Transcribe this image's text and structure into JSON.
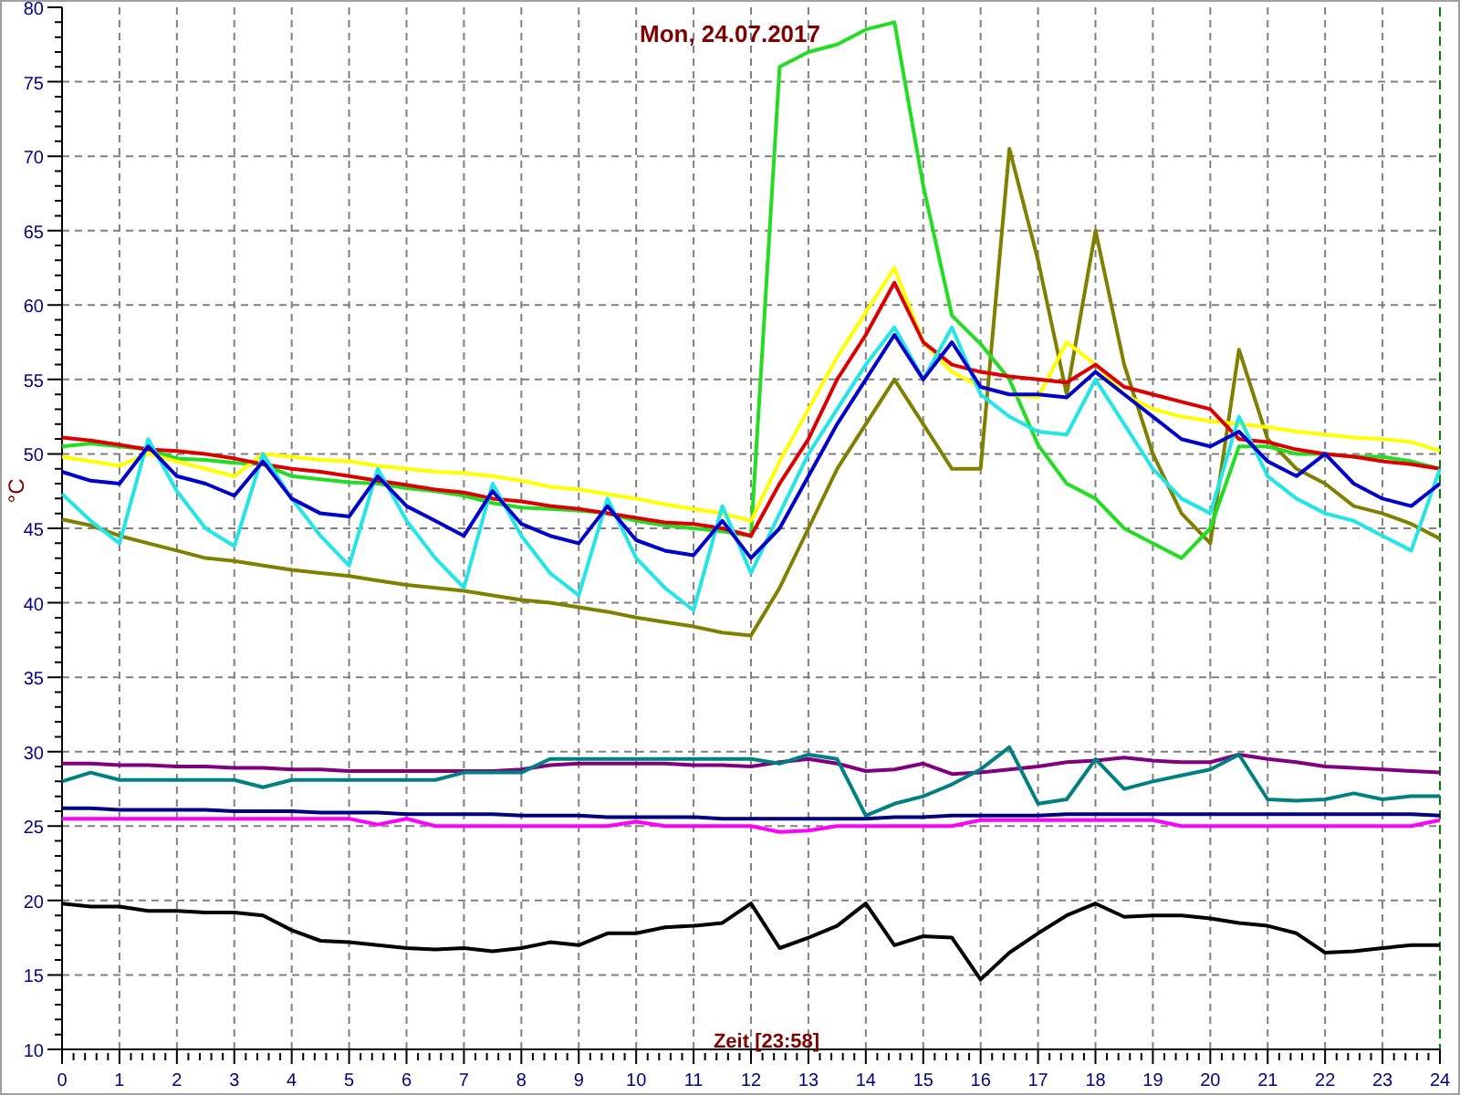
{
  "chart_data": {
    "type": "line",
    "title": "Mon, 24.07.2017",
    "xlabel": "Zeit [23:58]",
    "ylabel": "°C",
    "x": [
      0,
      0.5,
      1,
      1.5,
      2,
      2.5,
      3,
      3.5,
      4,
      4.5,
      5,
      5.5,
      6,
      6.5,
      7,
      7.5,
      8,
      8.5,
      9,
      9.5,
      10,
      10.5,
      11,
      11.5,
      12,
      12.5,
      13,
      13.5,
      14,
      14.5,
      15,
      15.5,
      16,
      16.5,
      17,
      17.5,
      18,
      18.5,
      19,
      19.5,
      20,
      20.5,
      21,
      21.5,
      22,
      22.5,
      23,
      23.5,
      24
    ],
    "grid": true,
    "xlim": [
      0,
      24
    ],
    "ylim": [
      10,
      80
    ],
    "xticks": [
      0,
      1,
      2,
      3,
      4,
      5,
      6,
      7,
      8,
      9,
      10,
      11,
      12,
      13,
      14,
      15,
      16,
      17,
      18,
      19,
      20,
      21,
      22,
      23,
      24
    ],
    "yticks": [
      10,
      15,
      20,
      25,
      30,
      35,
      40,
      45,
      50,
      55,
      60,
      65,
      70,
      75,
      80
    ],
    "series": [
      {
        "color": "#808000",
        "values": [
          45.6,
          45.2,
          44.5,
          44,
          43.5,
          43,
          42.8,
          42.5,
          42.2,
          42,
          41.8,
          41.5,
          41.2,
          41,
          40.8,
          40.5,
          40.2,
          40,
          39.7,
          39.4,
          39,
          38.7,
          38.4,
          38,
          37.8,
          41,
          45,
          49,
          52,
          55,
          52,
          49,
          49,
          70.5,
          63,
          54,
          65,
          56,
          50,
          46,
          44,
          57,
          51,
          49,
          48,
          46.5,
          46,
          45.3,
          44.3
        ]
      },
      {
        "color": "#22dd22",
        "values": [
          50.5,
          50.7,
          50.5,
          50.3,
          49.7,
          49.6,
          49.4,
          49.3,
          48.5,
          48.3,
          48.1,
          48,
          47.7,
          47.5,
          47.2,
          46.7,
          46.4,
          46.3,
          46.2,
          46,
          45.5,
          45.2,
          45,
          44.8,
          44.5,
          76,
          77,
          77.5,
          78.5,
          79,
          68,
          59.3,
          57.4,
          55,
          50.6,
          48,
          47,
          45,
          44,
          43,
          45,
          50.5,
          50.5,
          50,
          50,
          49.8,
          49.8,
          49.5,
          49
        ]
      },
      {
        "color": "#ffff00",
        "values": [
          49.8,
          49.5,
          49.2,
          50,
          49.5,
          49,
          48.5,
          50,
          49.8,
          49.6,
          49.5,
          49.2,
          49,
          48.8,
          48.7,
          48.5,
          48.2,
          47.8,
          47.6,
          47.3,
          47,
          46.6,
          46.3,
          46,
          45.5,
          49.5,
          53,
          56.5,
          59.5,
          62.5,
          57.5,
          55.5,
          54.5,
          54,
          53.8,
          57.5,
          56,
          54,
          53,
          52.5,
          52.2,
          52,
          51.8,
          51.5,
          51.3,
          51.1,
          51,
          50.8,
          50.2
        ]
      },
      {
        "color": "#dd0000",
        "values": [
          51.1,
          50.9,
          50.6,
          50.3,
          50.2,
          50,
          49.7,
          49.3,
          49,
          48.8,
          48.5,
          48.2,
          47.9,
          47.6,
          47.4,
          47,
          46.8,
          46.5,
          46.3,
          46,
          45.7,
          45.4,
          45.3,
          45,
          44.5,
          48,
          51,
          55,
          58,
          61.5,
          57.5,
          56,
          55.5,
          55.2,
          55,
          54.8,
          56,
          54.5,
          54,
          53.5,
          53,
          51,
          50.8,
          50.3,
          50,
          49.8,
          49.5,
          49.3,
          49
        ]
      },
      {
        "color": "#22e6e6",
        "values": [
          47.3,
          45.5,
          44,
          51,
          47.5,
          45,
          43.8,
          50,
          47,
          44.5,
          42.5,
          49,
          45.5,
          43,
          41,
          48,
          44.5,
          42,
          40.5,
          47,
          43,
          41,
          39.5,
          46.5,
          42,
          46,
          50,
          53,
          56,
          58.5,
          55,
          58.5,
          54,
          52.5,
          51.5,
          51.3,
          55,
          52,
          49,
          47,
          46,
          52.5,
          48.5,
          47,
          46,
          45.5,
          44.5,
          43.5,
          49
        ]
      },
      {
        "color": "#0000cc",
        "values": [
          48.8,
          48.2,
          48,
          50.5,
          48.5,
          48,
          47.2,
          49.5,
          47,
          46,
          45.8,
          48.5,
          46.5,
          45.5,
          44.5,
          47.5,
          45.3,
          44.5,
          44,
          46.5,
          44.2,
          43.5,
          43.2,
          45.5,
          43,
          45,
          48.5,
          52,
          55,
          58,
          55,
          57.5,
          54.5,
          54,
          54,
          53.8,
          55.5,
          54,
          52.5,
          51,
          50.5,
          51.5,
          49.5,
          48.5,
          50,
          48,
          47,
          46.5,
          48
        ]
      },
      {
        "color": "#800080",
        "values": [
          29.2,
          29.2,
          29.1,
          29.1,
          29,
          29,
          28.9,
          28.9,
          28.8,
          28.8,
          28.7,
          28.7,
          28.7,
          28.7,
          28.7,
          28.7,
          28.8,
          29.1,
          29.2,
          29.2,
          29.2,
          29.2,
          29.1,
          29.1,
          29,
          29.3,
          29.5,
          29.2,
          28.7,
          28.8,
          29.2,
          28.5,
          28.6,
          28.8,
          29,
          29.3,
          29.4,
          29.6,
          29.4,
          29.3,
          29.3,
          29.8,
          29.5,
          29.3,
          29,
          28.9,
          28.8,
          28.7,
          28.6
        ]
      },
      {
        "color": "#008080",
        "values": [
          28,
          28.6,
          28.1,
          28.1,
          28.1,
          28.1,
          28.1,
          27.6,
          28.1,
          28.1,
          28.1,
          28.1,
          28.1,
          28.1,
          28.6,
          28.6,
          28.6,
          29.5,
          29.5,
          29.5,
          29.5,
          29.5,
          29.5,
          29.5,
          29.5,
          29.2,
          29.8,
          29.5,
          25.7,
          26.5,
          27,
          27.8,
          28.8,
          30.3,
          26.5,
          26.8,
          29.5,
          27.5,
          28,
          28.4,
          28.8,
          29.8,
          26.8,
          26.7,
          26.8,
          27.2,
          26.8,
          27,
          27
        ]
      },
      {
        "color": "#000080",
        "values": [
          26.2,
          26.2,
          26.1,
          26.1,
          26.1,
          26.1,
          26,
          26,
          26,
          25.9,
          25.9,
          25.9,
          25.8,
          25.8,
          25.8,
          25.8,
          25.7,
          25.7,
          25.7,
          25.6,
          25.6,
          25.6,
          25.6,
          25.5,
          25.5,
          25.5,
          25.5,
          25.5,
          25.5,
          25.6,
          25.6,
          25.7,
          25.7,
          25.7,
          25.7,
          25.8,
          25.8,
          25.8,
          25.8,
          25.8,
          25.8,
          25.8,
          25.8,
          25.8,
          25.8,
          25.8,
          25.8,
          25.8,
          25.7
        ]
      },
      {
        "color": "#ff00ff",
        "values": [
          25.5,
          25.5,
          25.5,
          25.5,
          25.5,
          25.5,
          25.5,
          25.5,
          25.5,
          25.5,
          25.5,
          25.1,
          25.5,
          25,
          25,
          25,
          25,
          25,
          25,
          25,
          25.3,
          25,
          25,
          25,
          25,
          24.6,
          24.7,
          25,
          25,
          25,
          25,
          25,
          25.4,
          25.4,
          25.4,
          25.4,
          25.4,
          25.4,
          25.4,
          25,
          25,
          25,
          25,
          25,
          25,
          25,
          25,
          25,
          25.4
        ]
      },
      {
        "color": "#000000",
        "values": [
          19.8,
          19.6,
          19.6,
          19.3,
          19.3,
          19.2,
          19.2,
          19,
          18,
          17.3,
          17.2,
          17,
          16.8,
          16.7,
          16.8,
          16.6,
          16.8,
          17.2,
          17,
          17.8,
          17.8,
          18.2,
          18.3,
          18.5,
          19.8,
          16.8,
          17.5,
          18.3,
          19.8,
          17,
          17.6,
          17.5,
          14.7,
          16.5,
          17.8,
          19,
          19.8,
          18.9,
          19,
          19,
          18.8,
          18.5,
          18.3,
          17.8,
          16.5,
          16.6,
          16.8,
          17,
          17
        ]
      }
    ]
  }
}
